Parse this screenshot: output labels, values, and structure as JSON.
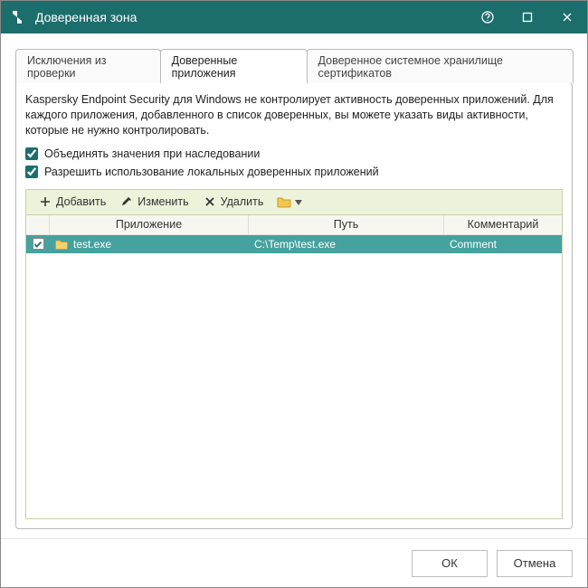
{
  "window": {
    "title": "Доверенная зона"
  },
  "tabs": {
    "exclusions": "Исключения из проверки",
    "trusted_apps": "Доверенные приложения",
    "cert_store": "Доверенное системное хранилище сертификатов"
  },
  "panel": {
    "description": "Kaspersky Endpoint Security для Windows не контролирует активность доверенных приложений. Для каждого приложения, добавленного в список доверенных, вы можете указать виды активности, которые не нужно контролировать.",
    "merge_label": "Объединять значения при наследовании",
    "allow_local_label": "Разрешить использование локальных доверенных приложений"
  },
  "toolbar": {
    "add": "Добавить",
    "edit": "Изменить",
    "delete": "Удалить"
  },
  "columns": {
    "app": "Приложение",
    "path": "Путь",
    "comment": "Комментарий"
  },
  "rows": [
    {
      "checked": true,
      "app": "test.exe",
      "path": "C:\\Temp\\test.exe",
      "comment": "Comment"
    }
  ],
  "footer": {
    "ok": "ОК",
    "cancel": "Отмена"
  }
}
